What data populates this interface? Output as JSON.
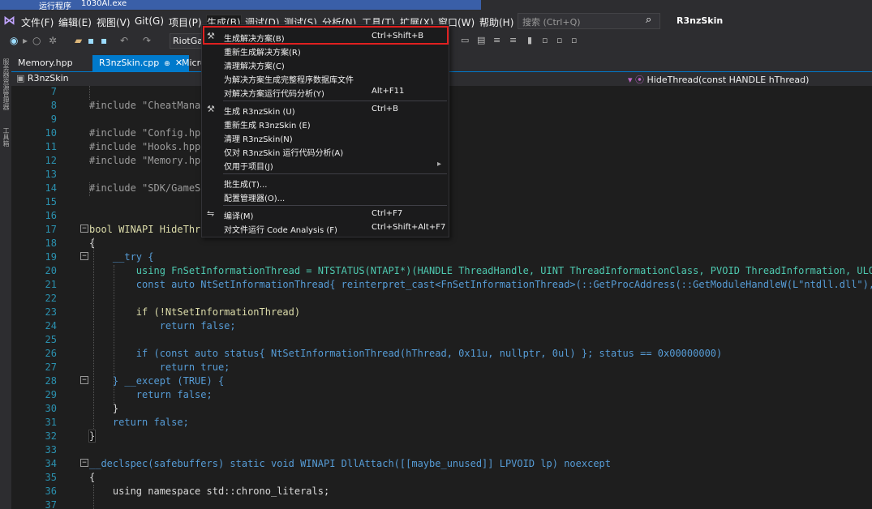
{
  "topstrip": {
    "left_text": "运行程序",
    "file_text": "1030AI.exe"
  },
  "menubar": {
    "items": [
      "文件(F)",
      "编辑(E)",
      "视图(V)",
      "Git(G)",
      "项目(P)",
      "生成(B)",
      "调试(D)",
      "测试(S)",
      "分析(N)",
      "工具(T)",
      "扩展(X)",
      "窗口(W)",
      "帮助(H)"
    ],
    "search_placeholder": "搜索 (Ctrl+Q)",
    "solution_name": "R3nzSkin"
  },
  "toolbar": {
    "config_combo": "RiotGar"
  },
  "tabs": [
    {
      "label": "Memory.hpp",
      "active": false
    },
    {
      "label": "R3nzSkin.cpp",
      "active": true,
      "pin": "⊕",
      "close": "✕"
    },
    {
      "label": "Micro",
      "active": false
    }
  ],
  "navbar": {
    "project": "R3nzSkin",
    "function": "HideThread(const HANDLE hThread)"
  },
  "leftstrip": {
    "labels": [
      "服务器资源管理器",
      "工具箱"
    ]
  },
  "build_menu": {
    "items": [
      {
        "label": "生成解决方案(B)",
        "shortcut": "Ctrl+Shift+B",
        "icon": "build-icon"
      },
      {
        "label": "重新生成解决方案(R)",
        "shortcut": ""
      },
      {
        "label": "清理解决方案(C)",
        "shortcut": ""
      },
      {
        "label": "为解决方案生成完整程序数据库文件",
        "shortcut": ""
      },
      {
        "label": "对解决方案运行代码分析(Y)",
        "shortcut": "Alt+F11"
      },
      {
        "label": "生成 R3nzSkin (U)",
        "shortcut": "Ctrl+B",
        "icon": "build-icon"
      },
      {
        "label": "重新生成 R3nzSkin (E)",
        "shortcut": ""
      },
      {
        "label": "清理 R3nzSkin(N)",
        "shortcut": ""
      },
      {
        "label": "仅对 R3nzSkin 运行代码分析(A)",
        "shortcut": ""
      },
      {
        "label": "仅用于项目(J)",
        "shortcut": "",
        "submenu": "▸"
      },
      {
        "label": "批生成(T)...",
        "shortcut": ""
      },
      {
        "label": "配置管理器(O)...",
        "shortcut": ""
      },
      {
        "label": "编译(M)",
        "shortcut": "Ctrl+F7",
        "icon": "compile-icon"
      },
      {
        "label": "对文件运行 Code Analysis (F)",
        "shortcut": "Ctrl+Shift+Alt+F7"
      }
    ]
  },
  "code": {
    "lines": [
      {
        "n": "7",
        "t": ""
      },
      {
        "n": "8",
        "t": "#include \"CheatManag"
      },
      {
        "n": "9",
        "t": ""
      },
      {
        "n": "10",
        "t": "#include \"Config.hpp"
      },
      {
        "n": "11",
        "t": "#include \"Hooks.hpp\""
      },
      {
        "n": "12",
        "t": "#include \"Memory.hpp"
      },
      {
        "n": "13",
        "t": ""
      },
      {
        "n": "14",
        "t": "#include \"SDK/GameSt"
      },
      {
        "n": "15",
        "t": ""
      },
      {
        "n": "16",
        "t": ""
      },
      {
        "n": "17",
        "t": "bool WINAPI HideThre"
      },
      {
        "n": "18",
        "t": "{"
      },
      {
        "n": "19",
        "t": "    __try {"
      },
      {
        "n": "20",
        "t": "        using FnSetInformationThread = NTSTATUS(NTAPI*)(HANDLE ThreadHandle, UINT ThreadInformationClass, PVOID ThreadInformation, ULONG Thre"
      },
      {
        "n": "21",
        "t": "        const auto NtSetInformationThread{ reinterpret_cast<FnSetInformationThread>(::GetProcAddress(::GetModuleHandleW(L\"ntdll.dll\"), \"NtSet"
      },
      {
        "n": "22",
        "t": ""
      },
      {
        "n": "23",
        "t": "        if (!NtSetInformationThread)"
      },
      {
        "n": "24",
        "t": "            return false;"
      },
      {
        "n": "25",
        "t": ""
      },
      {
        "n": "26",
        "t": "        if (const auto status{ NtSetInformationThread(hThread, 0x11u, nullptr, 0ul) }; status == 0x00000000)"
      },
      {
        "n": "27",
        "t": "            return true;"
      },
      {
        "n": "28",
        "t": "    } __except (TRUE) {"
      },
      {
        "n": "29",
        "t": "        return false;"
      },
      {
        "n": "30",
        "t": "    }"
      },
      {
        "n": "31",
        "t": "    return false;"
      },
      {
        "n": "32",
        "t": "}"
      },
      {
        "n": "33",
        "t": ""
      },
      {
        "n": "34",
        "t": "__declspec(safebuffers) static void WINAPI DllAttach([[maybe_unused]] LPVOID lp) noexcept"
      },
      {
        "n": "35",
        "t": "{"
      },
      {
        "n": "36",
        "t": "    using namespace std::chrono_literals;"
      },
      {
        "n": "37",
        "t": ""
      }
    ]
  }
}
